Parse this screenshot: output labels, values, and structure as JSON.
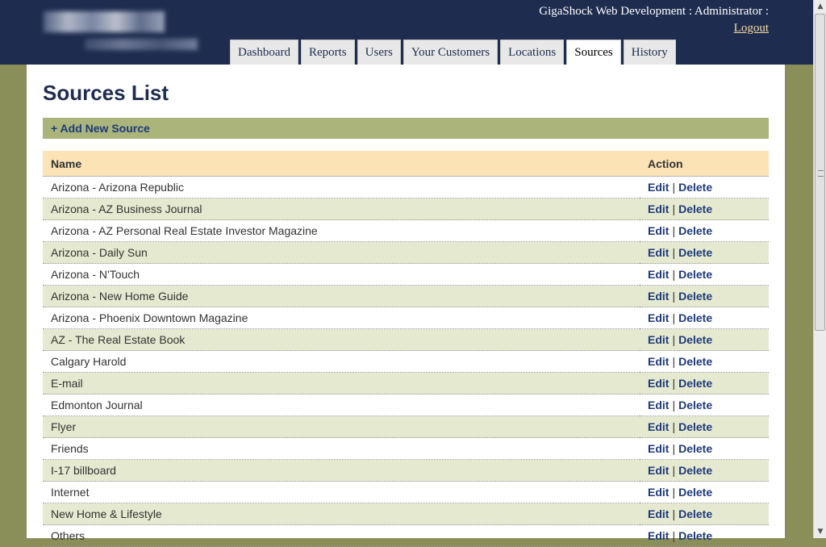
{
  "header": {
    "user_line": "GigaShock Web Development : Administrator :",
    "logout": "Logout",
    "tabs": [
      {
        "label": "Dashboard"
      },
      {
        "label": "Reports"
      },
      {
        "label": "Users"
      },
      {
        "label": "Your Customers"
      },
      {
        "label": "Locations"
      },
      {
        "label": "Sources"
      },
      {
        "label": "History"
      }
    ],
    "active_tab": "Sources"
  },
  "page": {
    "title": "Sources List",
    "add_new": "+ Add New Source"
  },
  "table": {
    "headers": {
      "name": "Name",
      "action": "Action"
    },
    "edit_label": "Edit",
    "delete_label": "Delete",
    "separator": "|",
    "rows": [
      "Arizona - Arizona Republic",
      "Arizona - AZ Business Journal",
      "Arizona - AZ Personal Real Estate Investor Magazine",
      "Arizona - Daily Sun",
      "Arizona - N'Touch",
      "Arizona - New Home Guide",
      "Arizona - Phoenix Downtown Magazine",
      "AZ - The Real Estate Book",
      "Calgary Harold",
      "E-mail",
      "Edmonton Journal",
      "Flyer",
      "Friends",
      "I-17 billboard",
      "Internet",
      "New Home & Lifestyle",
      "Others"
    ]
  },
  "colors": {
    "header_bg": "#1e2c4f",
    "page_bg": "#8a8f5a",
    "add_bar": "#aab47b",
    "table_header": "#fbe3b5",
    "row_alt": "#e5e9d0",
    "link": "#1e3a7a"
  },
  "scrollbar": {
    "up_icon": "arrow-up-icon",
    "down_icon": "arrow-down-icon"
  }
}
